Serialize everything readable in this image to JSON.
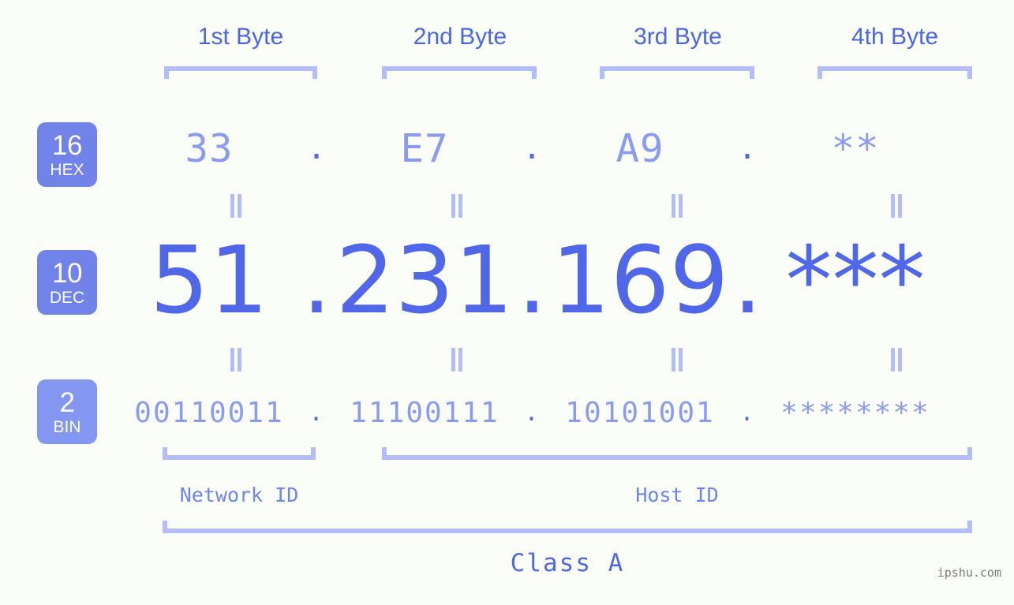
{
  "background_color": "#fbfdf9",
  "accent_colors": {
    "strong_blue": "#5068e8",
    "light_blue": "#8b9bef",
    "bracket_blue": "#b3bdfa",
    "badge_blue": "#7183e8",
    "badge_blue_light": "#8397f2",
    "header_blue": "#4a66e0",
    "watermark_gray": "#7b7b7b"
  },
  "byte_headers": [
    {
      "label": "1st Byte"
    },
    {
      "label": "2nd Byte"
    },
    {
      "label": "3rd Byte"
    },
    {
      "label": "4th Byte"
    }
  ],
  "bases": [
    {
      "num": "16",
      "label": "HEX"
    },
    {
      "num": "10",
      "label": "DEC"
    },
    {
      "num": "2",
      "label": "BIN"
    }
  ],
  "rows": {
    "hex": {
      "base_num": "16",
      "base_label": "HEX",
      "values": [
        "33",
        "E7",
        "A9",
        "**"
      ],
      "separator": "."
    },
    "dec": {
      "base_num": "10",
      "base_label": "DEC",
      "values": [
        "51",
        "231",
        "169",
        "***"
      ],
      "separator": "."
    },
    "bin": {
      "base_num": "2",
      "base_label": "BIN",
      "values": [
        "00110011",
        "11100111",
        "10101001",
        "********"
      ],
      "separator": "."
    }
  },
  "equals_marker": "=",
  "id_labels": {
    "network": "Network ID",
    "host": "Host ID"
  },
  "class_label": "Class A",
  "watermark": "ipshu.com"
}
